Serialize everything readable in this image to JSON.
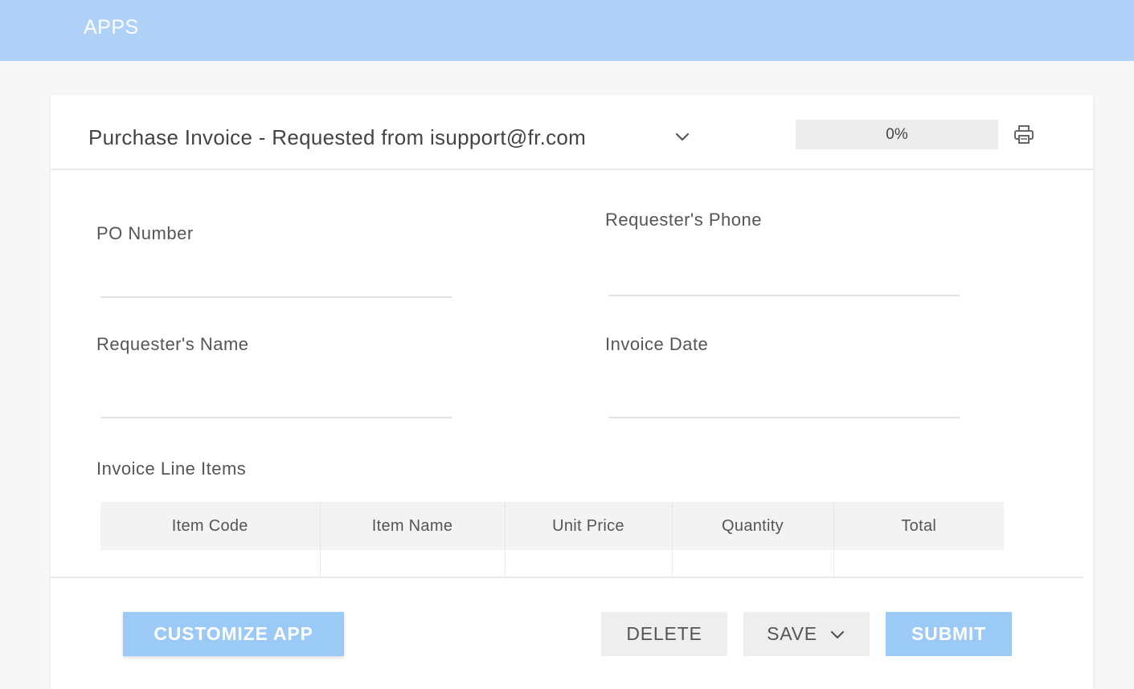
{
  "topbar": {
    "title": "APPS"
  },
  "form": {
    "title": "Purchase Invoice - Requested from isupport@fr.com",
    "progress": "0%",
    "progress_value": 0
  },
  "fields": {
    "po_number": {
      "label": "PO Number",
      "value": ""
    },
    "requester_phone": {
      "label": "Requester's Phone",
      "value": ""
    },
    "requester_name": {
      "label": "Requester's Name",
      "value": ""
    },
    "invoice_date": {
      "label": "Invoice Date",
      "value": ""
    }
  },
  "line_items": {
    "label": "Invoice Line Items",
    "columns": [
      "Item Code",
      "Item Name",
      "Unit Price",
      "Quantity",
      "Total"
    ],
    "rows": []
  },
  "footer": {
    "customize_label": "CUSTOMIZE APP",
    "delete_label": "DELETE",
    "save_label": "SAVE",
    "submit_label": "SUBMIT"
  },
  "icons": {
    "dropdown": "chevron-down-icon",
    "print": "printer-icon"
  },
  "colors": {
    "topbar": "#afd0f7",
    "primary_button": "#9ccaf7",
    "secondary_button": "#eeeeee"
  }
}
